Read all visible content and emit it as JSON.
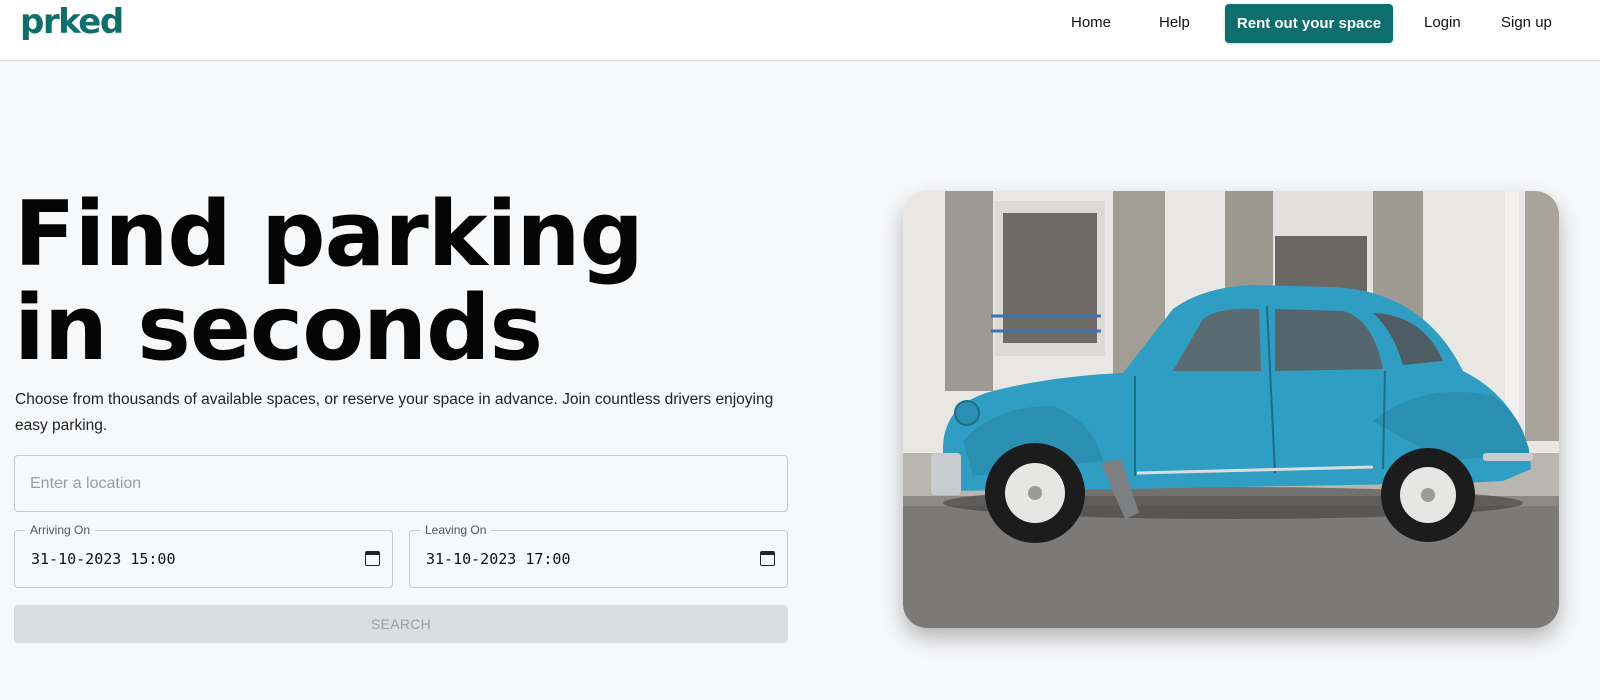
{
  "header": {
    "logo": "prked",
    "nav": {
      "home": "Home",
      "help": "Help",
      "rent": "Rent out your space",
      "login": "Login",
      "signup": "Sign up"
    }
  },
  "hero": {
    "title_line1": "Find parking",
    "title_line2": "in seconds",
    "subtitle": "Choose from thousands of available spaces, or reserve your space in advance. Join countless drivers enjoying easy parking."
  },
  "search": {
    "location_placeholder": "Enter a location",
    "arriving_label": "Arriving On",
    "arriving_value": "31-10-2023 15:00",
    "leaving_label": "Leaving On",
    "leaving_value": "31-10-2023 17:00",
    "button_label": "SEARCH"
  },
  "icons": {
    "calendar": "calendar-icon"
  },
  "colors": {
    "brand": "#0e6e6c",
    "background": "#f7f8fa",
    "search_disabled": "#dcdddf",
    "car": "#2f9ec2"
  }
}
